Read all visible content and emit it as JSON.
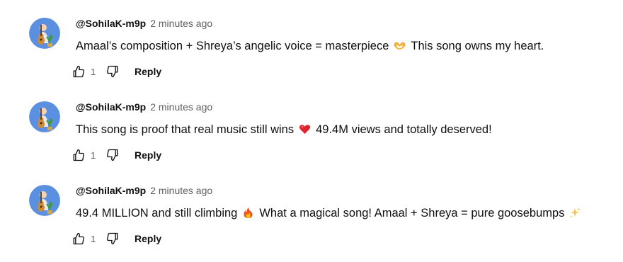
{
  "comments": [
    {
      "author": "@SohilaK-m9p",
      "time": "2 minutes ago",
      "text_before": "Amaal’s composition + Shreya’s angelic voice = masterpiece",
      "emoji_1": "heart-hands-emoji",
      "text_after": "This song owns my heart.",
      "likes": "1",
      "reply_label": "Reply"
    },
    {
      "author": "@SohilaK-m9p",
      "time": "2 minutes ago",
      "text_before": "This song is proof that real music still wins",
      "emoji_1": "red-heart-emoji",
      "text_after": "49.4M views and totally deserved!",
      "likes": "1",
      "reply_label": "Reply"
    },
    {
      "author": "@SohilaK-m9p",
      "time": "2 minutes ago",
      "text_before": "49.4 MILLION and still climbing",
      "emoji_1": "fire-emoji",
      "text_after": "What a magical song! Amaal + Shreya = pure goosebumps",
      "emoji_2": "sparkles-emoji",
      "likes": "1",
      "reply_label": "Reply"
    }
  ],
  "colors": {
    "avatar_bg": "#5b8fe0",
    "secondary_text": "#606060",
    "primary_text": "#0f0f0f"
  }
}
